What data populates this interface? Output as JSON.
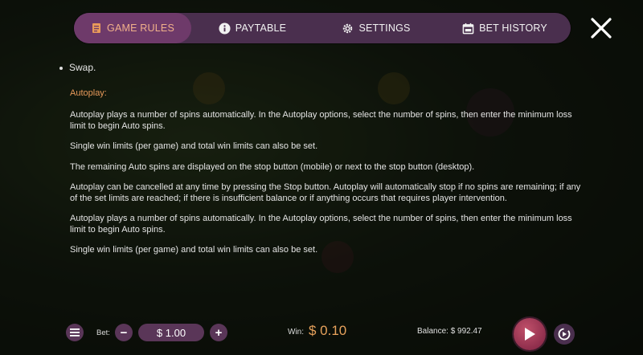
{
  "tabs": [
    {
      "label": "GAME RULES",
      "icon": "document-icon",
      "active": true
    },
    {
      "label": "PAYTABLE",
      "icon": "info-icon",
      "active": false
    },
    {
      "label": "SETTINGS",
      "icon": "gear-icon",
      "active": false
    },
    {
      "label": "BET HISTORY",
      "icon": "calendar-icon",
      "active": false
    }
  ],
  "rules": {
    "bullet": "Swap.",
    "section_title": "Autoplay:",
    "paragraphs": [
      "Autoplay plays a number of spins automatically. In the Autoplay options, select the number of spins, then enter the minimum loss limit to begin Auto spins.",
      "Single win limits (per game) and total win limits can also be set.",
      "The remaining Auto spins are displayed on the stop button (mobile) or next to the stop button (desktop).",
      "Autoplay can be cancelled at any time by pressing the Stop button. Autoplay will automatically stop if no spins are remaining; if any of the set limits are reached; if there is insufficient balance or if anything occurs that requires player intervention.",
      "Autoplay plays a number of spins automatically. In the Autoplay options, select the number of spins, then enter the minimum loss limit to begin Auto spins.",
      "Single win limits (per game) and total win limits can also be set."
    ]
  },
  "bottom": {
    "bet_label": "Bet:",
    "bet_value": "$ 1.00",
    "minus": "−",
    "plus": "+",
    "win_label": "Win:",
    "win_value": "$ 0.10",
    "balance": "Balance: $ 992.47"
  },
  "colors": {
    "tabbar": "#4a2f4e",
    "tab_active": "#6e3a6a",
    "accent": "#e89a5a"
  }
}
